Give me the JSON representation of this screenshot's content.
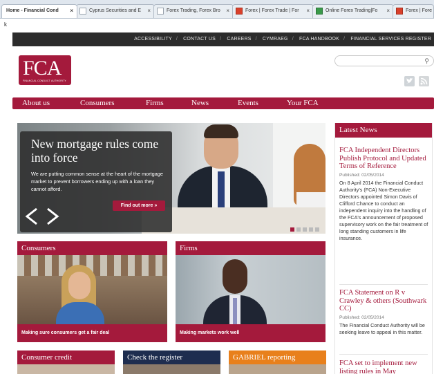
{
  "browser": {
    "tabs": [
      {
        "label": "Home - Financial Cond",
        "active": true,
        "favicon": ""
      },
      {
        "label": "Cyprus Securities and E",
        "active": false,
        "favicon": ""
      },
      {
        "label": "Forex Trading, Forex Bro",
        "active": false,
        "favicon": ""
      },
      {
        "label": "Forex | Forex Trade | For",
        "active": false,
        "favicon": "red"
      },
      {
        "label": "Online Forex Trading|Fo",
        "active": false,
        "favicon": "green"
      },
      {
        "label": "Forex | Fore",
        "active": false,
        "favicon": "red"
      }
    ],
    "close_glyph": "×",
    "url_text": "k"
  },
  "utility_nav": {
    "items": [
      "ACCESSIBILITY",
      "CONTACT US",
      "CAREERS",
      "CYMRAEG",
      "FCA HANDBOOK",
      "FINANCIAL SERVICES REGISTER"
    ],
    "separator": "/"
  },
  "logo": {
    "mark": "FCA",
    "subtitle": "FINANCIAL CONDUCT AUTHORITY"
  },
  "search": {
    "placeholder": "",
    "icon": "search-icon",
    "icon_glyph": "⚲"
  },
  "main_nav": {
    "items": [
      "About us",
      "Consumers",
      "Firms",
      "News",
      "Events",
      "Your FCA"
    ]
  },
  "hero": {
    "title": "New mortgage rules come into force",
    "body": "We are putting common sense at the heart of the mortgage market to prevent borrowers ending up with a loan they cannot afford.",
    "button": "Find out more »",
    "slide_index": 1,
    "slide_count": 5
  },
  "cards": {
    "consumers": {
      "title": "Consumers",
      "caption": "Making sure consumers get a fair deal"
    },
    "firms": {
      "title": "Firms",
      "caption": "Making markets work well"
    },
    "consumer_credit": {
      "title": "Consumer credit"
    },
    "check_register": {
      "title": "Check the register"
    },
    "gabriel": {
      "title": "GABRIEL reporting"
    }
  },
  "news": {
    "header": "Latest News",
    "items": [
      {
        "title": "FCA Independent Directors Publish Protocol and Updated Terms of Reference",
        "date": "Published: 02/05/2014",
        "body": "On 8 April 2014 the Financial Conduct Authority's (FCA) Non-Executive Directors appointed Simon Davis of Clifford Chance to conduct an independent inquiry into the handling of the FCA's announcement of proposed supervisory work on the fair treatment of long standing customers in life insurance."
      },
      {
        "title": "FCA Statement on R v Crawley & others (Southwark CC)",
        "date": "Published: 02/05/2014",
        "body": "The Financial Conduct Authority will be seeking leave to appeal in this matter."
      },
      {
        "title": "FCA set to implement new listing rules in May",
        "date": "",
        "body": ""
      }
    ]
  },
  "colors": {
    "brand": "#a41a3c",
    "navy": "#1e2d4f",
    "orange": "#e8801c"
  }
}
